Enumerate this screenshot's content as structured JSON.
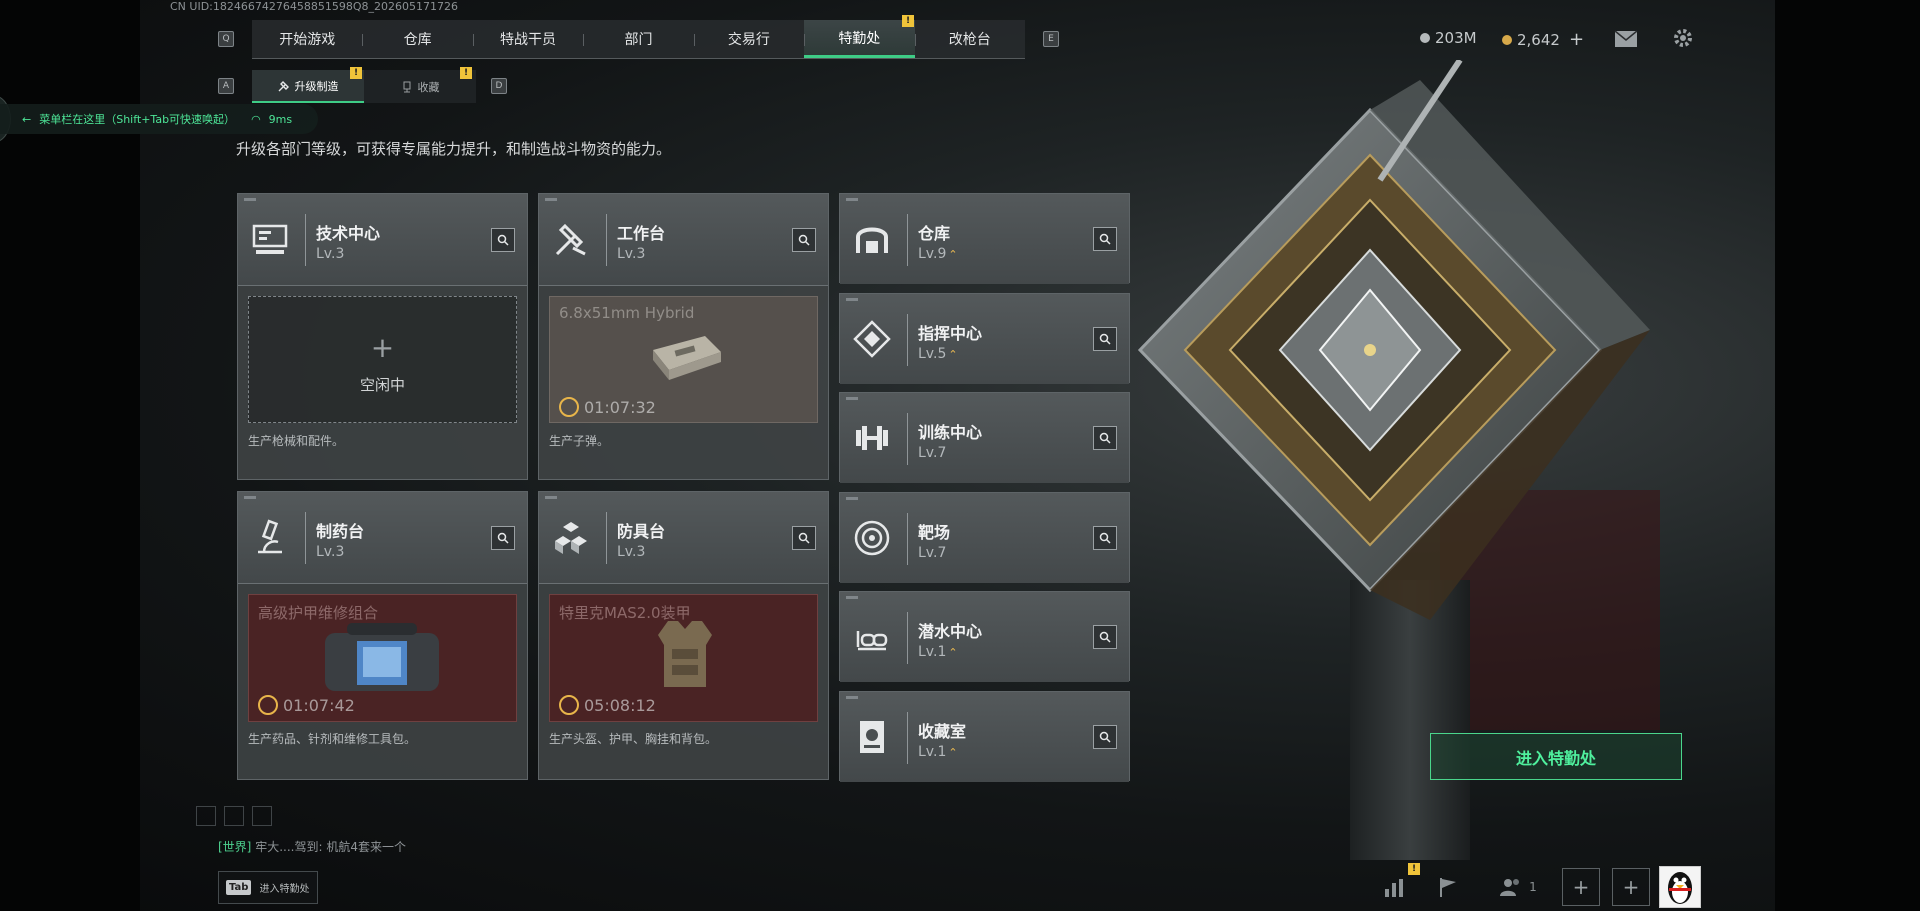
{
  "uid": "CN UID:18246674276458851598Q8_202605171726",
  "top_nav": {
    "left_key": "Q",
    "right_key": "E",
    "tabs": [
      {
        "label": "开始游戏"
      },
      {
        "label": "仓库"
      },
      {
        "label": "特战干员"
      },
      {
        "label": "部门"
      },
      {
        "label": "交易行"
      },
      {
        "label": "特勤处",
        "active": true,
        "badge": "!"
      },
      {
        "label": "改枪台"
      }
    ]
  },
  "sub_nav": {
    "left_key": "A",
    "right_key": "D",
    "tabs": [
      {
        "label": "升级制造",
        "active": true,
        "badge": "!"
      },
      {
        "label": "收藏",
        "badge": "!"
      }
    ]
  },
  "notice": {
    "text": "菜单栏在这里（Shift+Tab可快速唤起）",
    "ping": "9ms"
  },
  "description": "升级各部门等级，可获得专属能力提升，和制造战斗物资的能力。",
  "production_cards": [
    {
      "name": "技术中心",
      "level": "Lv.3",
      "icon": "computer-icon",
      "slot_state": "idle",
      "slot_label": "空闲中",
      "desc": "生产枪械和配件。"
    },
    {
      "name": "工作台",
      "level": "Lv.3",
      "icon": "tools-icon",
      "slot_state": "producing",
      "item": "6.8x51mm Hybrid",
      "timer": "01:07:32",
      "desc": "生产子弹。"
    },
    {
      "name": "制药台",
      "level": "Lv.3",
      "icon": "microscope-icon",
      "slot_state": "producing",
      "item": "高级护甲维修组合",
      "timer": "01:07:42",
      "desc": "生产药品、针剂和维修工具包。"
    },
    {
      "name": "防具台",
      "level": "Lv.3",
      "icon": "blocks-icon",
      "slot_state": "producing",
      "item": "特里克MAS2.0装甲",
      "timer": "05:08:12",
      "desc": "生产头盔、护甲、胸挂和背包。"
    }
  ],
  "facilities": [
    {
      "name": "仓库",
      "level": "Lv.9",
      "upgradable": true,
      "icon": "vault-icon"
    },
    {
      "name": "指挥中心",
      "level": "Lv.5",
      "upgradable": true,
      "icon": "command-icon"
    },
    {
      "name": "训练中心",
      "level": "Lv.7",
      "upgradable": false,
      "icon": "dumbbell-icon"
    },
    {
      "name": "靶场",
      "level": "Lv.7",
      "upgradable": false,
      "icon": "target-icon"
    },
    {
      "name": "潜水中心",
      "level": "Lv.1",
      "upgradable": true,
      "icon": "diving-mask-icon"
    },
    {
      "name": "收藏室",
      "level": "Lv.1",
      "upgradable": true,
      "icon": "collection-icon"
    }
  ],
  "enter_button": "进入特勤处",
  "currency": {
    "silver": "203M",
    "gold": "2,642",
    "gold_add": "+"
  },
  "chat": {
    "channel": "[世界]",
    "message": "牢大....驾到: 机航4套来一个"
  },
  "tab_hint": {
    "key": "Tab",
    "label": "进入特勤处"
  },
  "bottom_bar": {
    "stats_badge": "!",
    "friends_count": "1"
  },
  "colors": {
    "accent_green": "#3ecc86",
    "badge_yellow": "#f0c43a",
    "upgrade_gold": "#e9b850"
  }
}
